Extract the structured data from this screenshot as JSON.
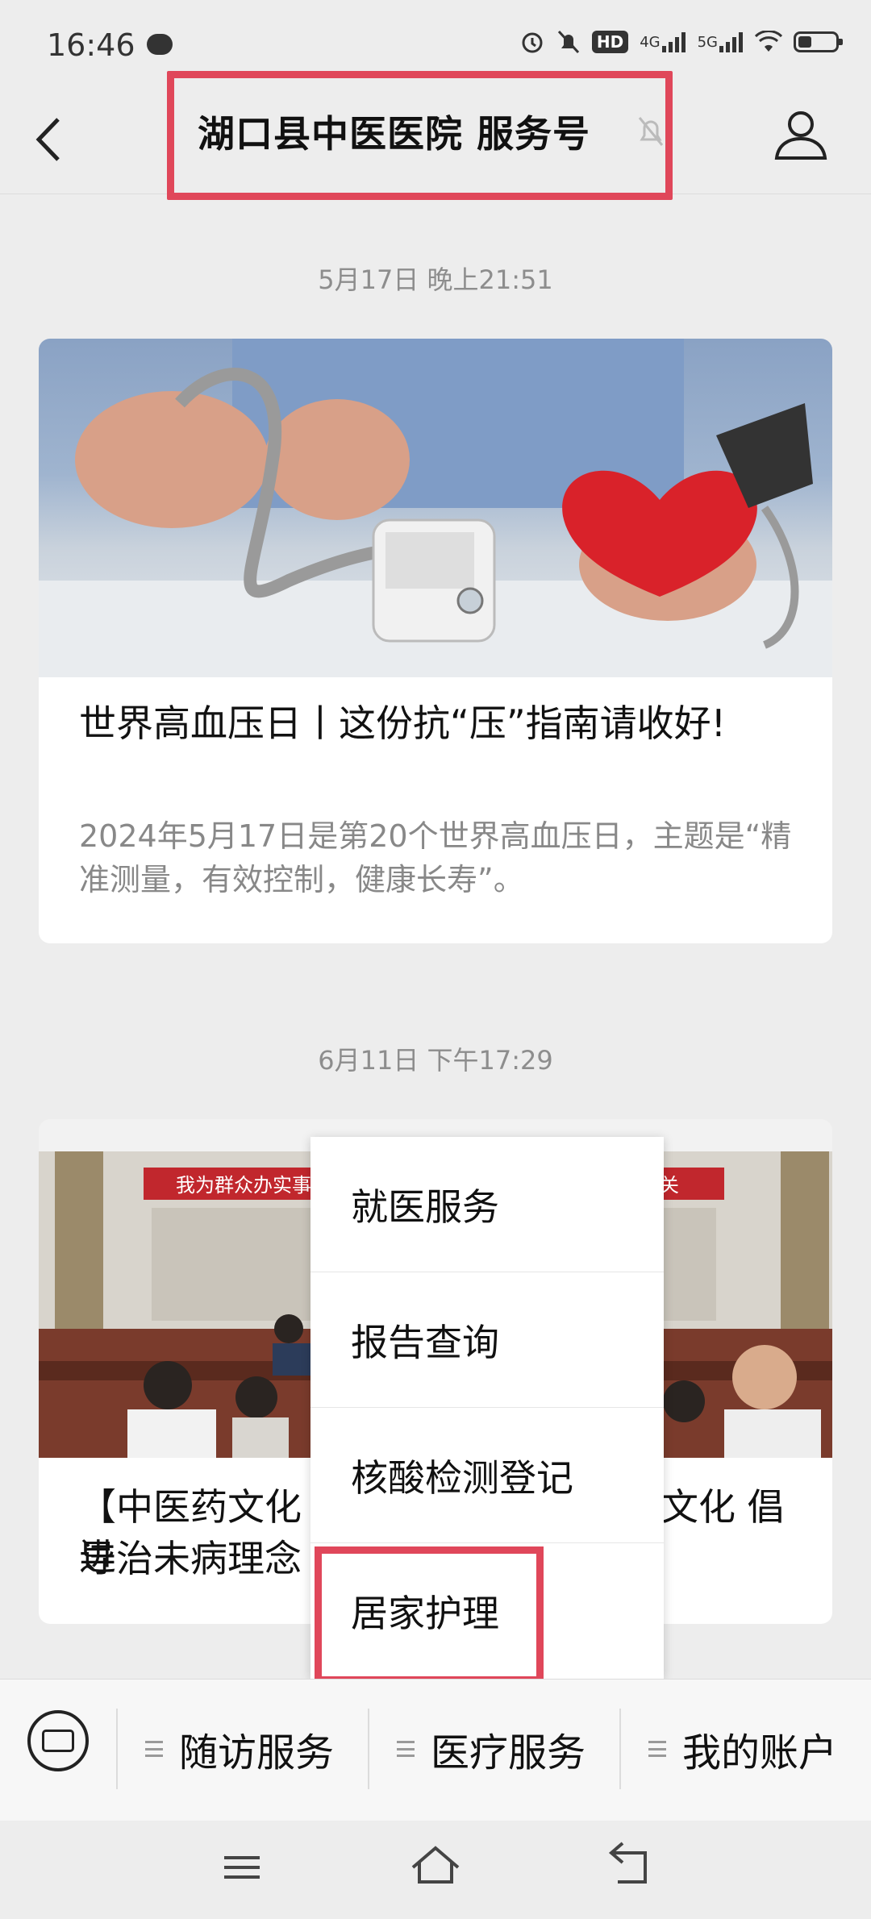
{
  "status_bar": {
    "time": "16:46",
    "network_1": "4G",
    "network_2": "5G",
    "hd": "HD"
  },
  "header": {
    "title": "湖口县中医医院 服务号",
    "back_icon": "chevron-left-icon",
    "mute_icon": "bell-off-icon",
    "profile_icon": "person-icon"
  },
  "messages": [
    {
      "date": "5月17日 晚上21:51",
      "title": "世界高血压日丨这份抗“压”指南请收好!",
      "digest": "2024年5月17日是第20个世界高血压日，主题是“精准测量，有效控制，健康长寿”。"
    },
    {
      "date": "6月11日 下午17:29",
      "banner": "我为群众办实事",
      "banner_end": "关",
      "title_left": "【中医药文化进",
      "title_right": "文化 倡",
      "title_line2": "导治未病理念"
    }
  ],
  "popup_menu": {
    "items": [
      "就医服务",
      "报告查询",
      "核酸检测登记",
      "居家护理"
    ]
  },
  "bottom_menu": {
    "items": [
      "随访服务",
      "医疗服务",
      "我的账户"
    ]
  },
  "colors": {
    "highlight": "#e0475a",
    "background": "#ededed"
  }
}
